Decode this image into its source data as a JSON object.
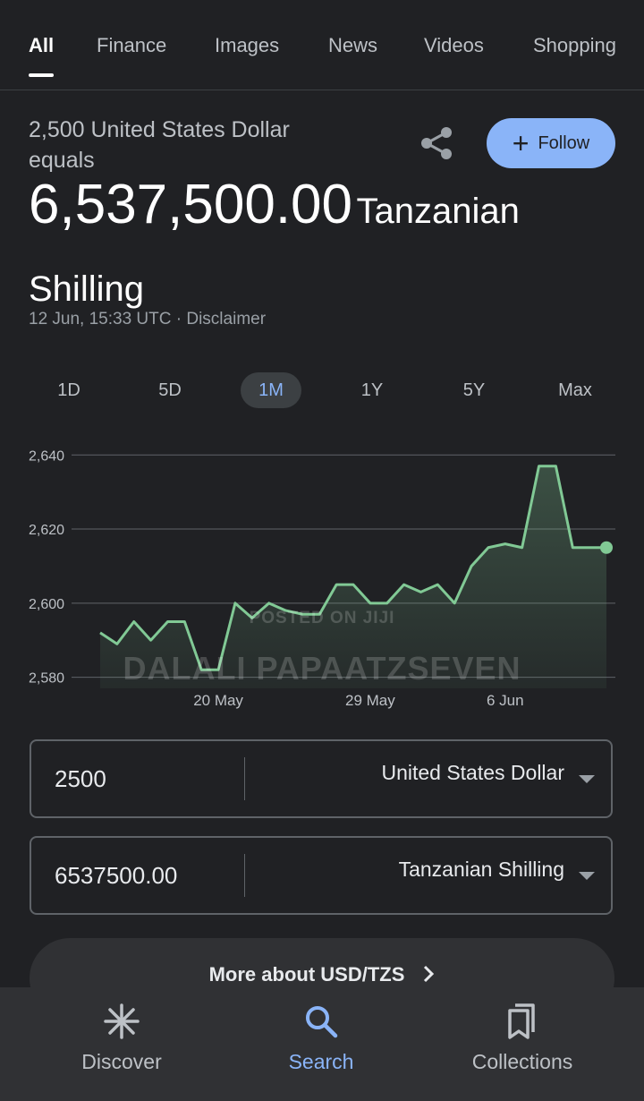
{
  "tabs": [
    "All",
    "Finance",
    "Images",
    "News",
    "Videos",
    "Shopping"
  ],
  "header": {
    "equals_text": "2,500 United States Dollar equals",
    "result_amount": "6,537,500.00",
    "result_currency": "Tanzanian Shilling",
    "timestamp": "12 Jun, 15:33 UTC · Disclaimer",
    "follow_label": "Follow"
  },
  "ranges": [
    "1D",
    "5D",
    "1M",
    "1Y",
    "5Y",
    "Max"
  ],
  "active_range": "1M",
  "chart_data": {
    "type": "area",
    "title": "",
    "xlabel": "",
    "ylabel": "",
    "y_ticks": [
      "2,640",
      "2,620",
      "2,600",
      "2,580"
    ],
    "ylim": [
      2577,
      2642
    ],
    "x_ticks": [
      "20 May",
      "29 May",
      "6 Jun"
    ],
    "values": [
      2592,
      2589,
      2595,
      2590,
      2595,
      2595,
      2582,
      2582,
      2600,
      2596,
      2600,
      2598,
      2597,
      2597,
      2605,
      2605,
      2600,
      2600,
      2605,
      2603,
      2605,
      2600,
      2610,
      2615,
      2616,
      2615,
      2637,
      2637,
      2615,
      2615,
      2615
    ],
    "line_color": "#81c995",
    "grid": true
  },
  "watermark": {
    "line1": "POSTED ON JIJI",
    "line2": "DALALI PAPAATZSEVEN"
  },
  "converter": {
    "from": {
      "value": "2500",
      "currency": "United States Dollar"
    },
    "to": {
      "value": "6537500.00",
      "currency": "Tanzanian Shilling"
    }
  },
  "more_label": "More about USD/TZS",
  "bottom_nav": [
    {
      "label": "Discover",
      "icon": "asterisk-icon"
    },
    {
      "label": "Search",
      "icon": "search-icon"
    },
    {
      "label": "Collections",
      "icon": "collections-icon"
    }
  ],
  "colors": {
    "accent": "#8ab4f8",
    "background": "#202124",
    "chart_line": "#81c995"
  }
}
